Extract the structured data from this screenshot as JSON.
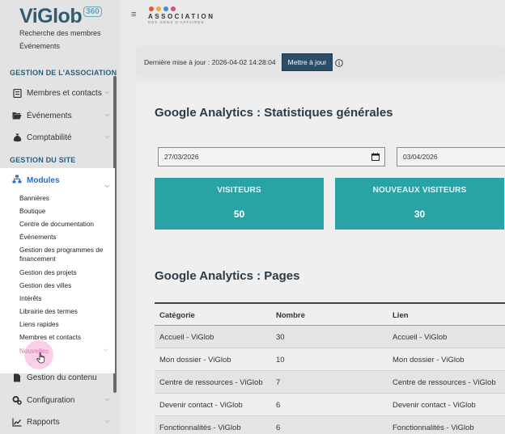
{
  "sidebar": {
    "logo_text": "ViGlob",
    "logo_badge": "360",
    "top_links": [
      "Recherche des membres",
      "Événements"
    ],
    "section_association": "GESTION DE L'ASSOCIATION",
    "association_items": [
      {
        "label": "Membres et contacts",
        "icon": "id-card-icon"
      },
      {
        "label": "Événements",
        "icon": "folder-open-icon"
      },
      {
        "label": "Comptabilité",
        "icon": "money-bag-icon"
      }
    ],
    "section_site": "GESTION DU SITE",
    "modules": {
      "label": "Modules",
      "icon": "sitemap-icon",
      "items": [
        "Bannières",
        "Boutique",
        "Centre de documentation",
        "Événements",
        "Gestion des programmes de financement",
        "Gestion des projets",
        "Gestion des villes",
        "Intérêts",
        "Librairie des termes",
        "Liens rapides",
        "Membres et contacts",
        "Nouvelles"
      ]
    },
    "bottom_items": [
      {
        "label": "Gestion du contenu",
        "icon": "page-icon"
      },
      {
        "label": "Configuration",
        "icon": "gears-icon"
      },
      {
        "label": "Rapports",
        "icon": "line-chart-icon"
      }
    ]
  },
  "topbar": {
    "hamburger": "≡",
    "association_name": "ASSOCIATION",
    "association_sub": "DES GENS D'AFFAIRES",
    "dot_colors": [
      "#e4572e",
      "#f2a93b",
      "#3b8fd8",
      "#d94b8c"
    ]
  },
  "update": {
    "label": "Dernière mise à jour : 2026-04-02 14:28:04",
    "button": "Mettre à jour",
    "info_icon": "info-circle-icon"
  },
  "stats_section": {
    "title": "Google Analytics : Statistiques générales",
    "date_from": "27/03/2026",
    "date_to": "03/04/2026",
    "cards": [
      {
        "label": "VISITEURS",
        "value": "50"
      },
      {
        "label": "NOUVEAUX VISITEURS",
        "value": "30"
      }
    ],
    "accent_color": "#2aa3a6"
  },
  "pages_section": {
    "title": "Google Analytics : Pages",
    "columns": [
      "Catégorie",
      "Nombre",
      "Lien"
    ],
    "rows": [
      [
        "Accueil - ViGlob",
        "30",
        "Accueil - ViGlob"
      ],
      [
        "Mon dossier - ViGlob",
        "10",
        "Mon dossier - ViGlob"
      ],
      [
        "Centre de ressources - ViGlob",
        "7",
        "Centre de ressources - ViGlob"
      ],
      [
        "Devenir contact - ViGlob",
        "6",
        "Devenir contact - ViGlob"
      ],
      [
        "Fonctionnalités - ViGlob",
        "6",
        "Fonctionnalités - ViGlob"
      ]
    ]
  }
}
